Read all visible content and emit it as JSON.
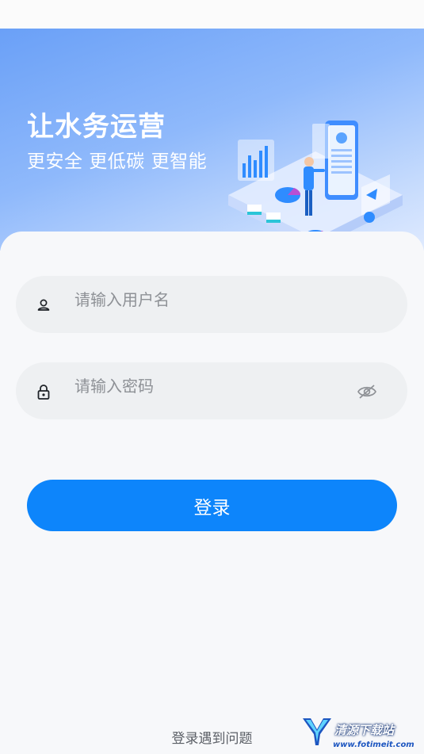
{
  "hero": {
    "title": "让水务运营",
    "subtitle": "更安全 更低碳 更智能"
  },
  "login_form": {
    "username": {
      "placeholder": "请输入用户名",
      "value": "",
      "icon": "user-icon"
    },
    "password": {
      "placeholder": "请输入密码",
      "value": "",
      "icon": "lock-icon",
      "toggle_icon": "eye-hidden-icon"
    },
    "submit_label": "登录",
    "help_label": "登录遇到问题"
  },
  "watermark": {
    "text": "清源下载站",
    "url": "www.fotimeit.com"
  },
  "colors": {
    "primary": "#0d85fb",
    "hero_gradient_start": "#6aa0f7",
    "hero_gradient_end": "#dfeafe",
    "input_bg": "#eef0f2",
    "page_bg": "#f7f8fa"
  }
}
